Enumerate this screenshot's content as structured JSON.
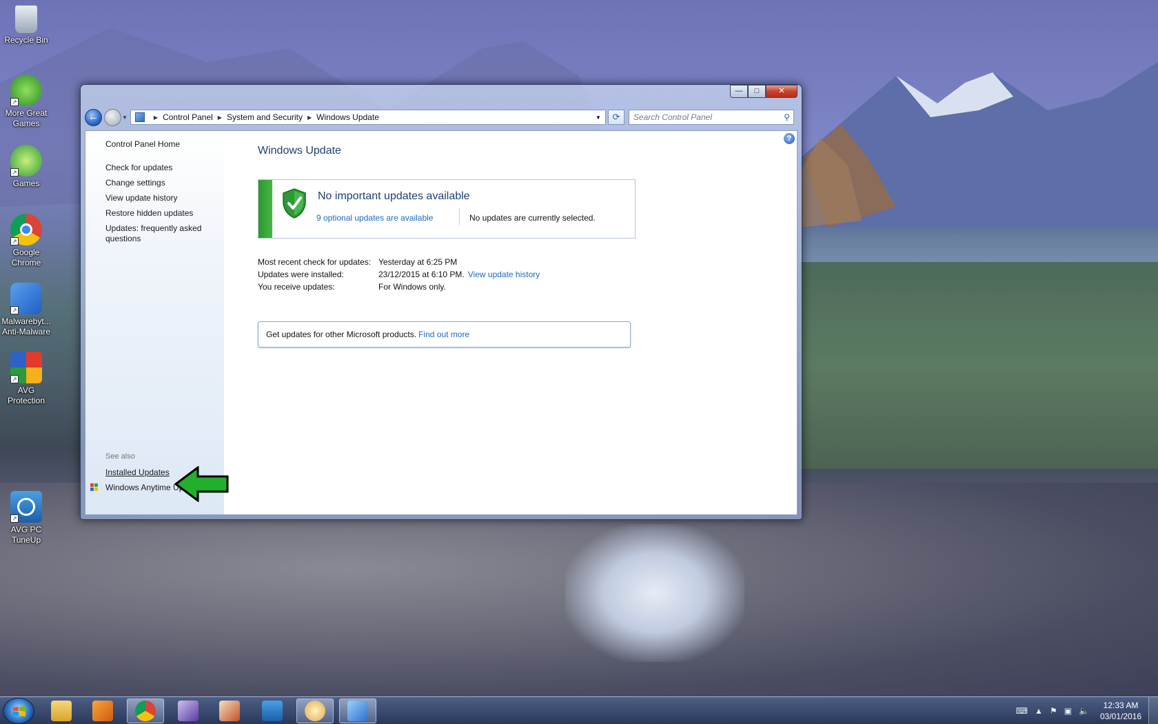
{
  "desktop": {
    "icons": [
      {
        "label": "Recycle Bin",
        "icon": "recycle-bin-icon"
      },
      {
        "label": "More Great Games",
        "icon": "games-frog-icon"
      },
      {
        "label": "Games",
        "icon": "big-fish-games-icon"
      },
      {
        "label": "Google Chrome",
        "icon": "chrome-icon"
      },
      {
        "label": "Malwarebyt... Anti-Malware",
        "icon": "malwarebytes-icon"
      },
      {
        "label": "AVG Protection",
        "icon": "avg-icon"
      },
      {
        "label": "AVG PC TuneUp",
        "icon": "avg-tuneup-icon"
      }
    ]
  },
  "window": {
    "caption_buttons": {
      "minimize": "—",
      "maximize": "□",
      "close": "✕"
    },
    "breadcrumb": [
      "Control Panel",
      "System and Security",
      "Windows Update"
    ],
    "search_placeholder": "Search Control Panel",
    "left_nav": {
      "home": "Control Panel Home",
      "items": [
        "Check for updates",
        "Change settings",
        "View update history",
        "Restore hidden updates",
        "Updates: frequently asked questions"
      ],
      "see_also_label": "See also",
      "see_also": [
        "Installed Updates",
        "Windows Anytime Upgrade"
      ]
    },
    "main": {
      "title": "Windows Update",
      "status_headline": "No important updates available",
      "optional_link": "9 optional updates are available",
      "no_selection": "No updates are currently selected.",
      "info": [
        {
          "key": "Most recent check for updates:",
          "value": "Yesterday at 6:25 PM",
          "link": ""
        },
        {
          "key": "Updates were installed:",
          "value": "23/12/2015 at 6:10 PM.",
          "link": "View update history"
        },
        {
          "key": "You receive updates:",
          "value": "For Windows only.",
          "link": ""
        }
      ],
      "get_updates_text": "Get updates for other Microsoft products.",
      "get_updates_link": "Find out more"
    }
  },
  "taskbar": {
    "apps": [
      "windows-explorer",
      "media-player",
      "chrome",
      "game-1",
      "game-2",
      "avg-tuneup",
      "paint",
      "control-panel"
    ],
    "clock_time": "12:33 AM",
    "clock_date": "03/01/2016"
  },
  "colors": {
    "accent_link": "#1a6bbf",
    "title_blue": "#1e3f72",
    "status_green": "#2a9a2a",
    "annotation_arrow": "#22b02c"
  }
}
